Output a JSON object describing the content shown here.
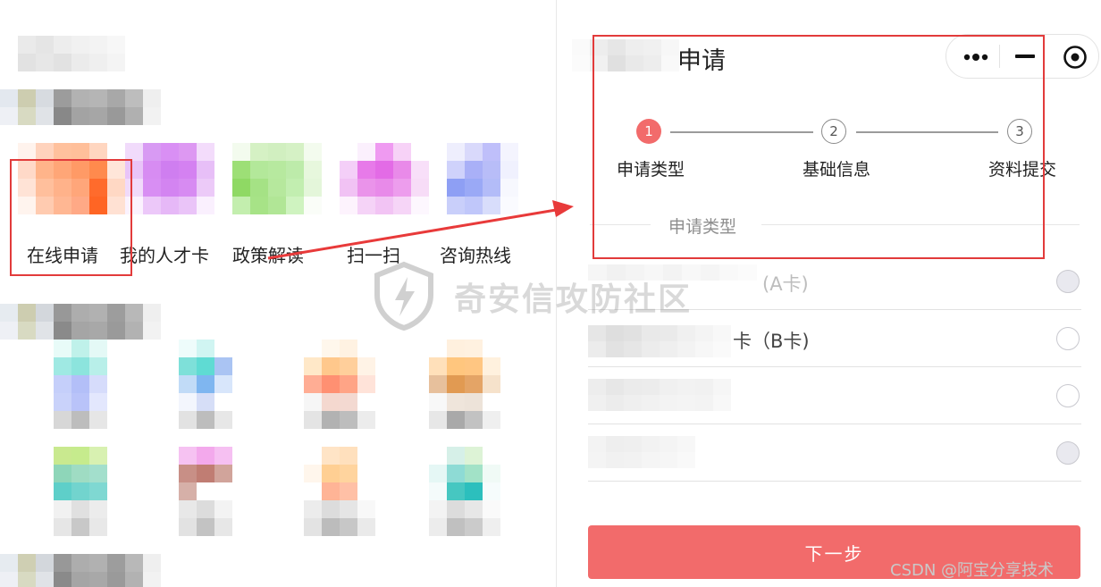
{
  "left_panel": {
    "icons": [
      {
        "label": "在线申请",
        "icon": "online-apply-icon"
      },
      {
        "label": "我的人才卡",
        "icon": "talent-card-icon"
      },
      {
        "label": "政策解读",
        "icon": "policy-icon"
      },
      {
        "label": "扫一扫",
        "icon": "scan-icon"
      },
      {
        "label": "咨询热线",
        "icon": "hotline-icon"
      }
    ]
  },
  "right_panel": {
    "page_title": "申请",
    "capsule": {
      "more_icon": "more-dots-icon",
      "minimize_icon": "minimize-icon",
      "close_icon": "target-close-icon"
    },
    "steps": [
      {
        "number": "1",
        "label": "申请类型",
        "active": true
      },
      {
        "number": "2",
        "label": "基础信息",
        "active": false
      },
      {
        "number": "3",
        "label": "资料提交",
        "active": false
      }
    ],
    "section_title": "申请类型",
    "options": [
      {
        "text": "(A卡)",
        "disabled": true
      },
      {
        "text": "卡（B卡)",
        "disabled": false
      },
      {
        "text": "",
        "disabled": false
      },
      {
        "text": "",
        "disabled": true
      }
    ],
    "next_button": "下一步"
  },
  "overlay": {
    "watermark": "奇安信攻防社区",
    "credit": "CSDN @阿宝分享技术"
  },
  "colors": {
    "accent": "#f26b6b",
    "highlight_box": "#e23b3b",
    "arrow": "#e83a3a"
  }
}
